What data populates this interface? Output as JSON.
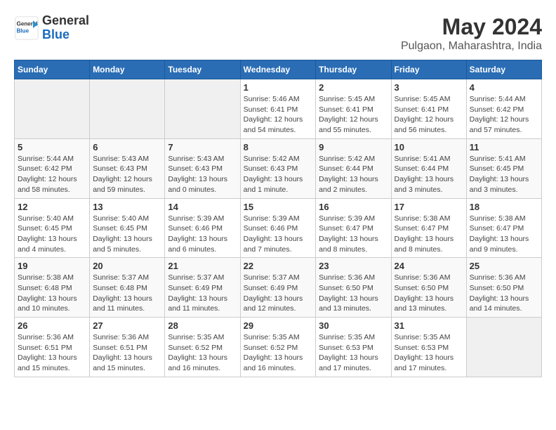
{
  "logo": {
    "line1": "General",
    "line2": "Blue"
  },
  "title": "May 2024",
  "subtitle": "Pulgaon, Maharashtra, India",
  "days_of_week": [
    "Sunday",
    "Monday",
    "Tuesday",
    "Wednesday",
    "Thursday",
    "Friday",
    "Saturday"
  ],
  "weeks": [
    [
      {
        "day": "",
        "info": ""
      },
      {
        "day": "",
        "info": ""
      },
      {
        "day": "",
        "info": ""
      },
      {
        "day": "1",
        "info": "Sunrise: 5:46 AM\nSunset: 6:41 PM\nDaylight: 12 hours\nand 54 minutes."
      },
      {
        "day": "2",
        "info": "Sunrise: 5:45 AM\nSunset: 6:41 PM\nDaylight: 12 hours\nand 55 minutes."
      },
      {
        "day": "3",
        "info": "Sunrise: 5:45 AM\nSunset: 6:41 PM\nDaylight: 12 hours\nand 56 minutes."
      },
      {
        "day": "4",
        "info": "Sunrise: 5:44 AM\nSunset: 6:42 PM\nDaylight: 12 hours\nand 57 minutes."
      }
    ],
    [
      {
        "day": "5",
        "info": "Sunrise: 5:44 AM\nSunset: 6:42 PM\nDaylight: 12 hours\nand 58 minutes."
      },
      {
        "day": "6",
        "info": "Sunrise: 5:43 AM\nSunset: 6:43 PM\nDaylight: 12 hours\nand 59 minutes."
      },
      {
        "day": "7",
        "info": "Sunrise: 5:43 AM\nSunset: 6:43 PM\nDaylight: 13 hours\nand 0 minutes."
      },
      {
        "day": "8",
        "info": "Sunrise: 5:42 AM\nSunset: 6:43 PM\nDaylight: 13 hours\nand 1 minute."
      },
      {
        "day": "9",
        "info": "Sunrise: 5:42 AM\nSunset: 6:44 PM\nDaylight: 13 hours\nand 2 minutes."
      },
      {
        "day": "10",
        "info": "Sunrise: 5:41 AM\nSunset: 6:44 PM\nDaylight: 13 hours\nand 3 minutes."
      },
      {
        "day": "11",
        "info": "Sunrise: 5:41 AM\nSunset: 6:45 PM\nDaylight: 13 hours\nand 3 minutes."
      }
    ],
    [
      {
        "day": "12",
        "info": "Sunrise: 5:40 AM\nSunset: 6:45 PM\nDaylight: 13 hours\nand 4 minutes."
      },
      {
        "day": "13",
        "info": "Sunrise: 5:40 AM\nSunset: 6:45 PM\nDaylight: 13 hours\nand 5 minutes."
      },
      {
        "day": "14",
        "info": "Sunrise: 5:39 AM\nSunset: 6:46 PM\nDaylight: 13 hours\nand 6 minutes."
      },
      {
        "day": "15",
        "info": "Sunrise: 5:39 AM\nSunset: 6:46 PM\nDaylight: 13 hours\nand 7 minutes."
      },
      {
        "day": "16",
        "info": "Sunrise: 5:39 AM\nSunset: 6:47 PM\nDaylight: 13 hours\nand 8 minutes."
      },
      {
        "day": "17",
        "info": "Sunrise: 5:38 AM\nSunset: 6:47 PM\nDaylight: 13 hours\nand 8 minutes."
      },
      {
        "day": "18",
        "info": "Sunrise: 5:38 AM\nSunset: 6:47 PM\nDaylight: 13 hours\nand 9 minutes."
      }
    ],
    [
      {
        "day": "19",
        "info": "Sunrise: 5:38 AM\nSunset: 6:48 PM\nDaylight: 13 hours\nand 10 minutes."
      },
      {
        "day": "20",
        "info": "Sunrise: 5:37 AM\nSunset: 6:48 PM\nDaylight: 13 hours\nand 11 minutes."
      },
      {
        "day": "21",
        "info": "Sunrise: 5:37 AM\nSunset: 6:49 PM\nDaylight: 13 hours\nand 11 minutes."
      },
      {
        "day": "22",
        "info": "Sunrise: 5:37 AM\nSunset: 6:49 PM\nDaylight: 13 hours\nand 12 minutes."
      },
      {
        "day": "23",
        "info": "Sunrise: 5:36 AM\nSunset: 6:50 PM\nDaylight: 13 hours\nand 13 minutes."
      },
      {
        "day": "24",
        "info": "Sunrise: 5:36 AM\nSunset: 6:50 PM\nDaylight: 13 hours\nand 13 minutes."
      },
      {
        "day": "25",
        "info": "Sunrise: 5:36 AM\nSunset: 6:50 PM\nDaylight: 13 hours\nand 14 minutes."
      }
    ],
    [
      {
        "day": "26",
        "info": "Sunrise: 5:36 AM\nSunset: 6:51 PM\nDaylight: 13 hours\nand 15 minutes."
      },
      {
        "day": "27",
        "info": "Sunrise: 5:36 AM\nSunset: 6:51 PM\nDaylight: 13 hours\nand 15 minutes."
      },
      {
        "day": "28",
        "info": "Sunrise: 5:35 AM\nSunset: 6:52 PM\nDaylight: 13 hours\nand 16 minutes."
      },
      {
        "day": "29",
        "info": "Sunrise: 5:35 AM\nSunset: 6:52 PM\nDaylight: 13 hours\nand 16 minutes."
      },
      {
        "day": "30",
        "info": "Sunrise: 5:35 AM\nSunset: 6:53 PM\nDaylight: 13 hours\nand 17 minutes."
      },
      {
        "day": "31",
        "info": "Sunrise: 5:35 AM\nSunset: 6:53 PM\nDaylight: 13 hours\nand 17 minutes."
      },
      {
        "day": "",
        "info": ""
      }
    ]
  ]
}
